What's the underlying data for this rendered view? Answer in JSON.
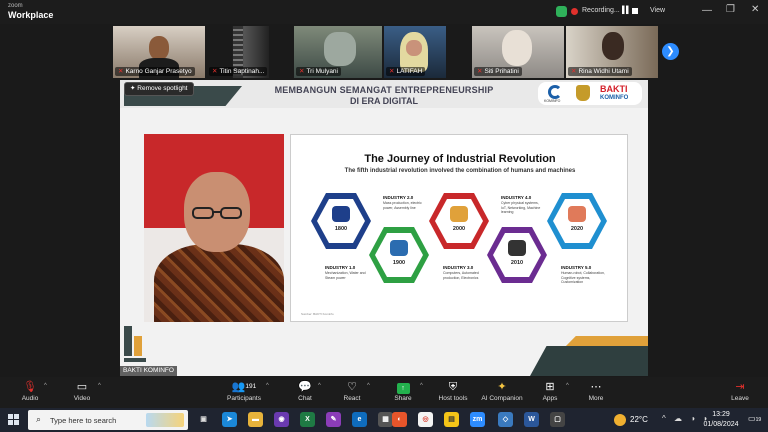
{
  "app": {
    "brand_line1": "zoom",
    "brand_line2": "Workplace"
  },
  "titlebar": {
    "recording_label": "Recording...",
    "view_label": "View",
    "min": "—",
    "max": "❐",
    "close": "✕"
  },
  "participants_strip": [
    {
      "name": "Karno Ganjar Prasetyo"
    },
    {
      "name": "Titin Saptinah..."
    },
    {
      "name": "Tri Mulyani"
    },
    {
      "name": "LATIFAH"
    },
    {
      "name": "Siti Prihatini"
    },
    {
      "name": "Rina Widhi Utami"
    }
  ],
  "spotlight": {
    "remove_label": "Remove spotlight"
  },
  "header": {
    "title_line1": "MEMBANGUN SEMANGAT ENTREPRENEURSHIP",
    "title_line2": "DI ERA DIGITAL",
    "logo_kominfo_text": "KOMINFO",
    "logo_bakti": "BAKTI",
    "logo_bakti_sub": "KOMINFO"
  },
  "slide": {
    "title": "The Journey of Industrial Revolution",
    "subtitle": "The fifth industrial revolution involved the combination of humans and machines",
    "hexes": [
      {
        "year": "1800",
        "color": "#1e3f8a"
      },
      {
        "year": "1900",
        "color": "#2ea043"
      },
      {
        "year": "2000",
        "color": "#c8282a"
      },
      {
        "year": "2010",
        "color": "#6b2c91"
      },
      {
        "year": "2020",
        "color": "#1f8fd0"
      }
    ],
    "industries": [
      {
        "label": "INDUSTRY 1.0",
        "desc": "Mechanization, Water and Steam power"
      },
      {
        "label": "INDUSTRY 2.0",
        "desc": "Mass production, electric power, Assembly line"
      },
      {
        "label": "INDUSTRY 3.0",
        "desc": "Computers, Automated production, Electronics"
      },
      {
        "label": "INDUSTRY 4.0",
        "desc": "Cyber physical systems, IoT, Networking, Machine learning"
      },
      {
        "label": "INDUSTRY 5.0",
        "desc": "Human-robot, Collaboration, Cognitive systems, Customization"
      }
    ],
    "source": "Sumber: BAKTI Kominfo"
  },
  "footer_tag": "BAKTI KOMINFO",
  "toolbar": {
    "audio": "Audio",
    "video": "Video",
    "participants": "Participants",
    "participants_count": "191",
    "chat": "Chat",
    "react": "React",
    "share": "Share",
    "host_tools": "Host tools",
    "ai_companion": "AI Companion",
    "apps": "Apps",
    "more": "More",
    "leave": "Leave"
  },
  "taskbar": {
    "search_placeholder": "Type here to search",
    "temperature": "22°C",
    "time": "13:29",
    "date": "01/08/2024",
    "notif_count": "19"
  },
  "colors": {
    "zoom_blue": "#2d8cff",
    "record_red": "#e0302c",
    "share_green": "#23b14d"
  }
}
